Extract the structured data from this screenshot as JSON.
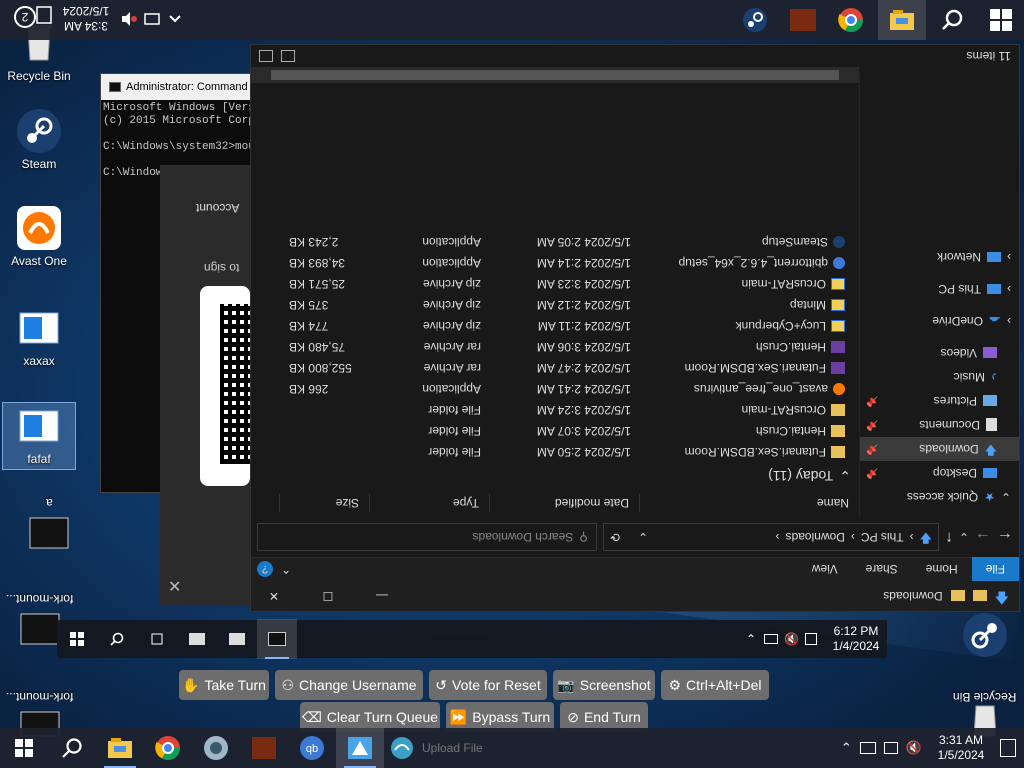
{
  "desktop_icons": [
    {
      "name": "recycle-bin",
      "label": "Recycle Bin"
    },
    {
      "name": "steam",
      "label": "Steam"
    },
    {
      "name": "avast-one",
      "label": "Avast One"
    },
    {
      "name": "xaxax",
      "label": "xaxax"
    },
    {
      "name": "fafaf",
      "label": "fafaf"
    },
    {
      "name": "a",
      "label": "a"
    },
    {
      "name": "fork-mount-1",
      "label": "fork-mount..."
    },
    {
      "name": "fork-mount-2",
      "label": "fork-mount..."
    },
    {
      "name": "recycle-bin-flipped",
      "label": "Recycle Bin"
    }
  ],
  "cmd": {
    "title": "Administrator: Command Pr",
    "line1": "Microsoft Windows [Vers",
    "line2": "(c) 2015 Microsoft Corp",
    "line3": "C:\\Windows\\system32>mou",
    "line4": "C:\\Window"
  },
  "login": {
    "account_text": "Account",
    "sign_in_text": "to sign"
  },
  "explorer": {
    "title": "Downloads",
    "tabs": [
      "File",
      "Home",
      "Share",
      "View"
    ],
    "breadcrumb": [
      "This PC",
      "Downloads"
    ],
    "search_placeholder": "Search Downloads",
    "columns": [
      "Name",
      "Date modified",
      "Type",
      "Size"
    ],
    "group_label": "Today (11)",
    "status": "11 items",
    "nav": [
      {
        "label": "Quick access"
      },
      {
        "label": "Desktop",
        "pinned": true
      },
      {
        "label": "Downloads",
        "pinned": true
      },
      {
        "label": "Documents",
        "pinned": true
      },
      {
        "label": "Pictures",
        "pinned": true
      },
      {
        "label": "Music"
      },
      {
        "label": "Videos"
      },
      {
        "label": "OneDrive"
      },
      {
        "label": "This PC"
      },
      {
        "label": "Network"
      }
    ],
    "files": [
      {
        "name": "Futanari.Sex.BDSM.Room",
        "date": "1/5/2024 2:50 AM",
        "type": "File folder",
        "size": "",
        "kind": "folder"
      },
      {
        "name": "Hentai.Crush",
        "date": "1/5/2024 3:07 AM",
        "type": "File folder",
        "size": "",
        "kind": "folder"
      },
      {
        "name": "OrcusRAT-main",
        "date": "1/5/2024 3:24 AM",
        "type": "File folder",
        "size": "",
        "kind": "folder"
      },
      {
        "name": "avast_one_free_antivirus",
        "date": "1/5/2024 2:41 AM",
        "type": "Application",
        "size": "266 KB",
        "kind": "avast"
      },
      {
        "name": "Futanari.Sex.BDSM.Room",
        "date": "1/5/2024 2:47 AM",
        "type": "rar Archive",
        "size": "552,800 KB",
        "kind": "rar"
      },
      {
        "name": "Hentai.Crush",
        "date": "1/5/2024 3:06 AM",
        "type": "rar Archive",
        "size": "75,480 KB",
        "kind": "rar"
      },
      {
        "name": "Lucy+Cyberpunk",
        "date": "1/5/2024 2:11 AM",
        "type": "zip Archive",
        "size": "774 KB",
        "kind": "zip"
      },
      {
        "name": "Mintap",
        "date": "1/5/2024 2:12 AM",
        "type": "zip Archive",
        "size": "375 KB",
        "kind": "zip"
      },
      {
        "name": "OrcusRAT-main",
        "date": "1/5/2024 3:23 AM",
        "type": "zip Archive",
        "size": "25,571 KB",
        "kind": "zip"
      },
      {
        "name": "qbittorrent_4.6.2_x64_setup",
        "date": "1/5/2024 2:14 AM",
        "type": "Application",
        "size": "34,893 KB",
        "kind": "qb"
      },
      {
        "name": "SteamSetup",
        "date": "1/5/2024 2:05 AM",
        "type": "Application",
        "size": "2,243 KB",
        "kind": "steam"
      }
    ]
  },
  "vm_taskbar": {
    "time": "6:12 PM",
    "date": "1/4/2024"
  },
  "vote_buttons": {
    "take_turn": "Take Turn",
    "change_username": "Change Username",
    "vote_reset": "Vote for Reset",
    "screenshot": "Screenshot",
    "ctrl_alt_del": "Ctrl+Alt+Del",
    "clear_queue": "Clear Turn Queue",
    "bypass_turn": "Bypass Turn",
    "end_turn": "End Turn"
  },
  "taskbar": {
    "time": "3:31 AM",
    "date": "1/5/2024",
    "faded_label": "Upload File"
  },
  "taskbar_top": {
    "time": "3:34 AM",
    "date": "1/5/2024",
    "badge": "2"
  },
  "colors": {
    "accent": "#1979ca",
    "vote_button": "#6d6d6d",
    "taskbar": "#1e222e"
  }
}
